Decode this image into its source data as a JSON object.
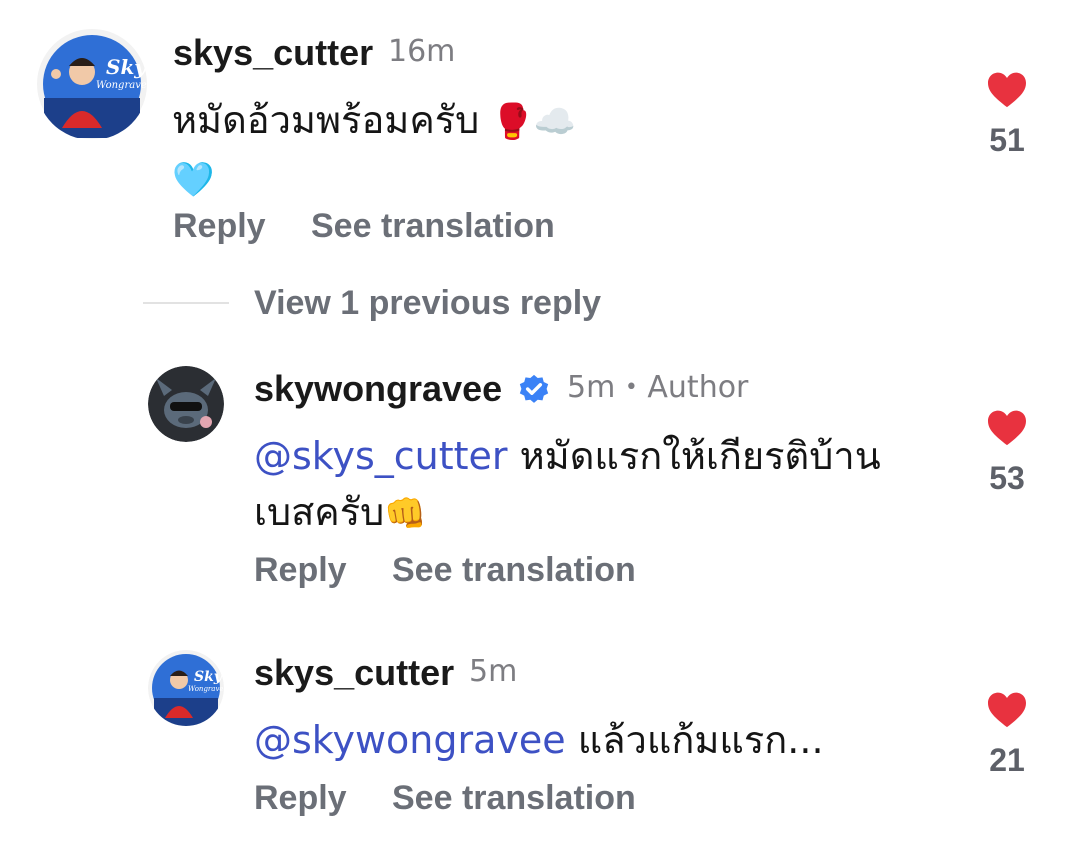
{
  "comment": {
    "username": "skys_cutter",
    "time": "16m",
    "text": "หมัดอ้วมพร้อมครับ",
    "likes": "51",
    "reply_label": "Reply",
    "translate_label": "See translation"
  },
  "view_replies_label": "View 1 previous reply",
  "replies": [
    {
      "username": "skywongravee",
      "verified": true,
      "time": "5m",
      "separator": "•",
      "author_label": "Author",
      "mention": "@skys_cutter",
      "text_line1": " หมัดแรกให้เกียรติบ้าน",
      "text_line2": "เบสครับ",
      "likes": "53",
      "reply_label": "Reply",
      "translate_label": "See translation"
    },
    {
      "username": "skys_cutter",
      "time": "5m",
      "mention": "@skywongravee",
      "text": " แล้วแก้มแรก...",
      "likes": "21",
      "reply_label": "Reply",
      "translate_label": "See translation"
    }
  ],
  "icons": {
    "heart": "heart-icon",
    "verified": "verified-badge-icon",
    "emoji_boxing": "boxing-glove-icon",
    "emoji_cloud": "cloud-icon",
    "emoji_heart": "light-blue-heart-icon",
    "emoji_fist": "fist-icon"
  },
  "colors": {
    "heart": "#e8323f",
    "mention": "#3d51c4",
    "verified": "#3b82f6",
    "secondary_text": "#6b6f77"
  }
}
